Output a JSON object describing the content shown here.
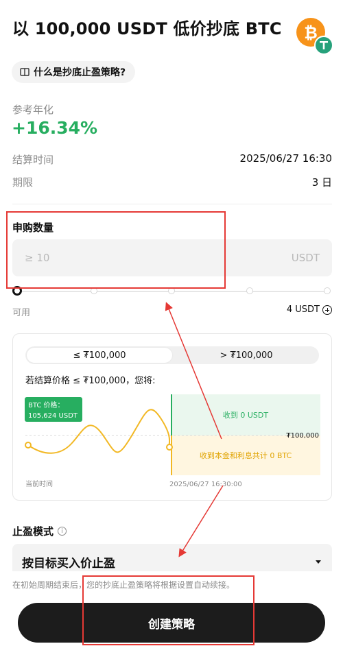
{
  "header": {
    "title": "以 100,000 USDT 低价抄底 BTC",
    "coins": [
      "bitcoin-icon",
      "tether-icon"
    ]
  },
  "help": {
    "label": "什么是抄底止盈策略?"
  },
  "yield": {
    "label": "参考年化",
    "value": "+16.34%"
  },
  "details": [
    {
      "label": "结算时间",
      "value": "2025/06/27 16:30"
    },
    {
      "label": "期限",
      "value": "3 日"
    }
  ],
  "subscribe": {
    "label": "申购数量",
    "placeholder": "≥ 10",
    "unit": "USDT",
    "slider_percent": 0,
    "available_label": "可用",
    "available_value": "4 USDT"
  },
  "scenario": {
    "tabs": [
      {
        "label": "≤ ₮100,000",
        "active": true
      },
      {
        "label": "> ₮100,000",
        "active": false
      }
    ],
    "description": "若结算价格 ≤ ₮100,000，您将:",
    "price_tag_line1": "BTC 价格：",
    "price_tag_line2": "105,624 USDT",
    "upper_outcome": "收到 0 USDT",
    "lower_outcome": "收到本金和利息共计 0 BTC",
    "strike_label": "₮100,000",
    "start_label": "当前时间",
    "end_label": "2025/06/27 16:30:00"
  },
  "take_profit": {
    "label": "止盈模式",
    "selected": "按目标买入价止盈",
    "note": "在初始周期结束后，您的抄底止盈策略将根据设置自动续接。"
  },
  "action": {
    "label": "创建策略"
  },
  "colors": {
    "accent_green": "#27ae60",
    "price_line": "#f2b824",
    "upper_zone": "#eaf7ee",
    "lower_zone": "#fff6e0",
    "annotation_red": "#e53935",
    "button": "#1c1c1c"
  }
}
